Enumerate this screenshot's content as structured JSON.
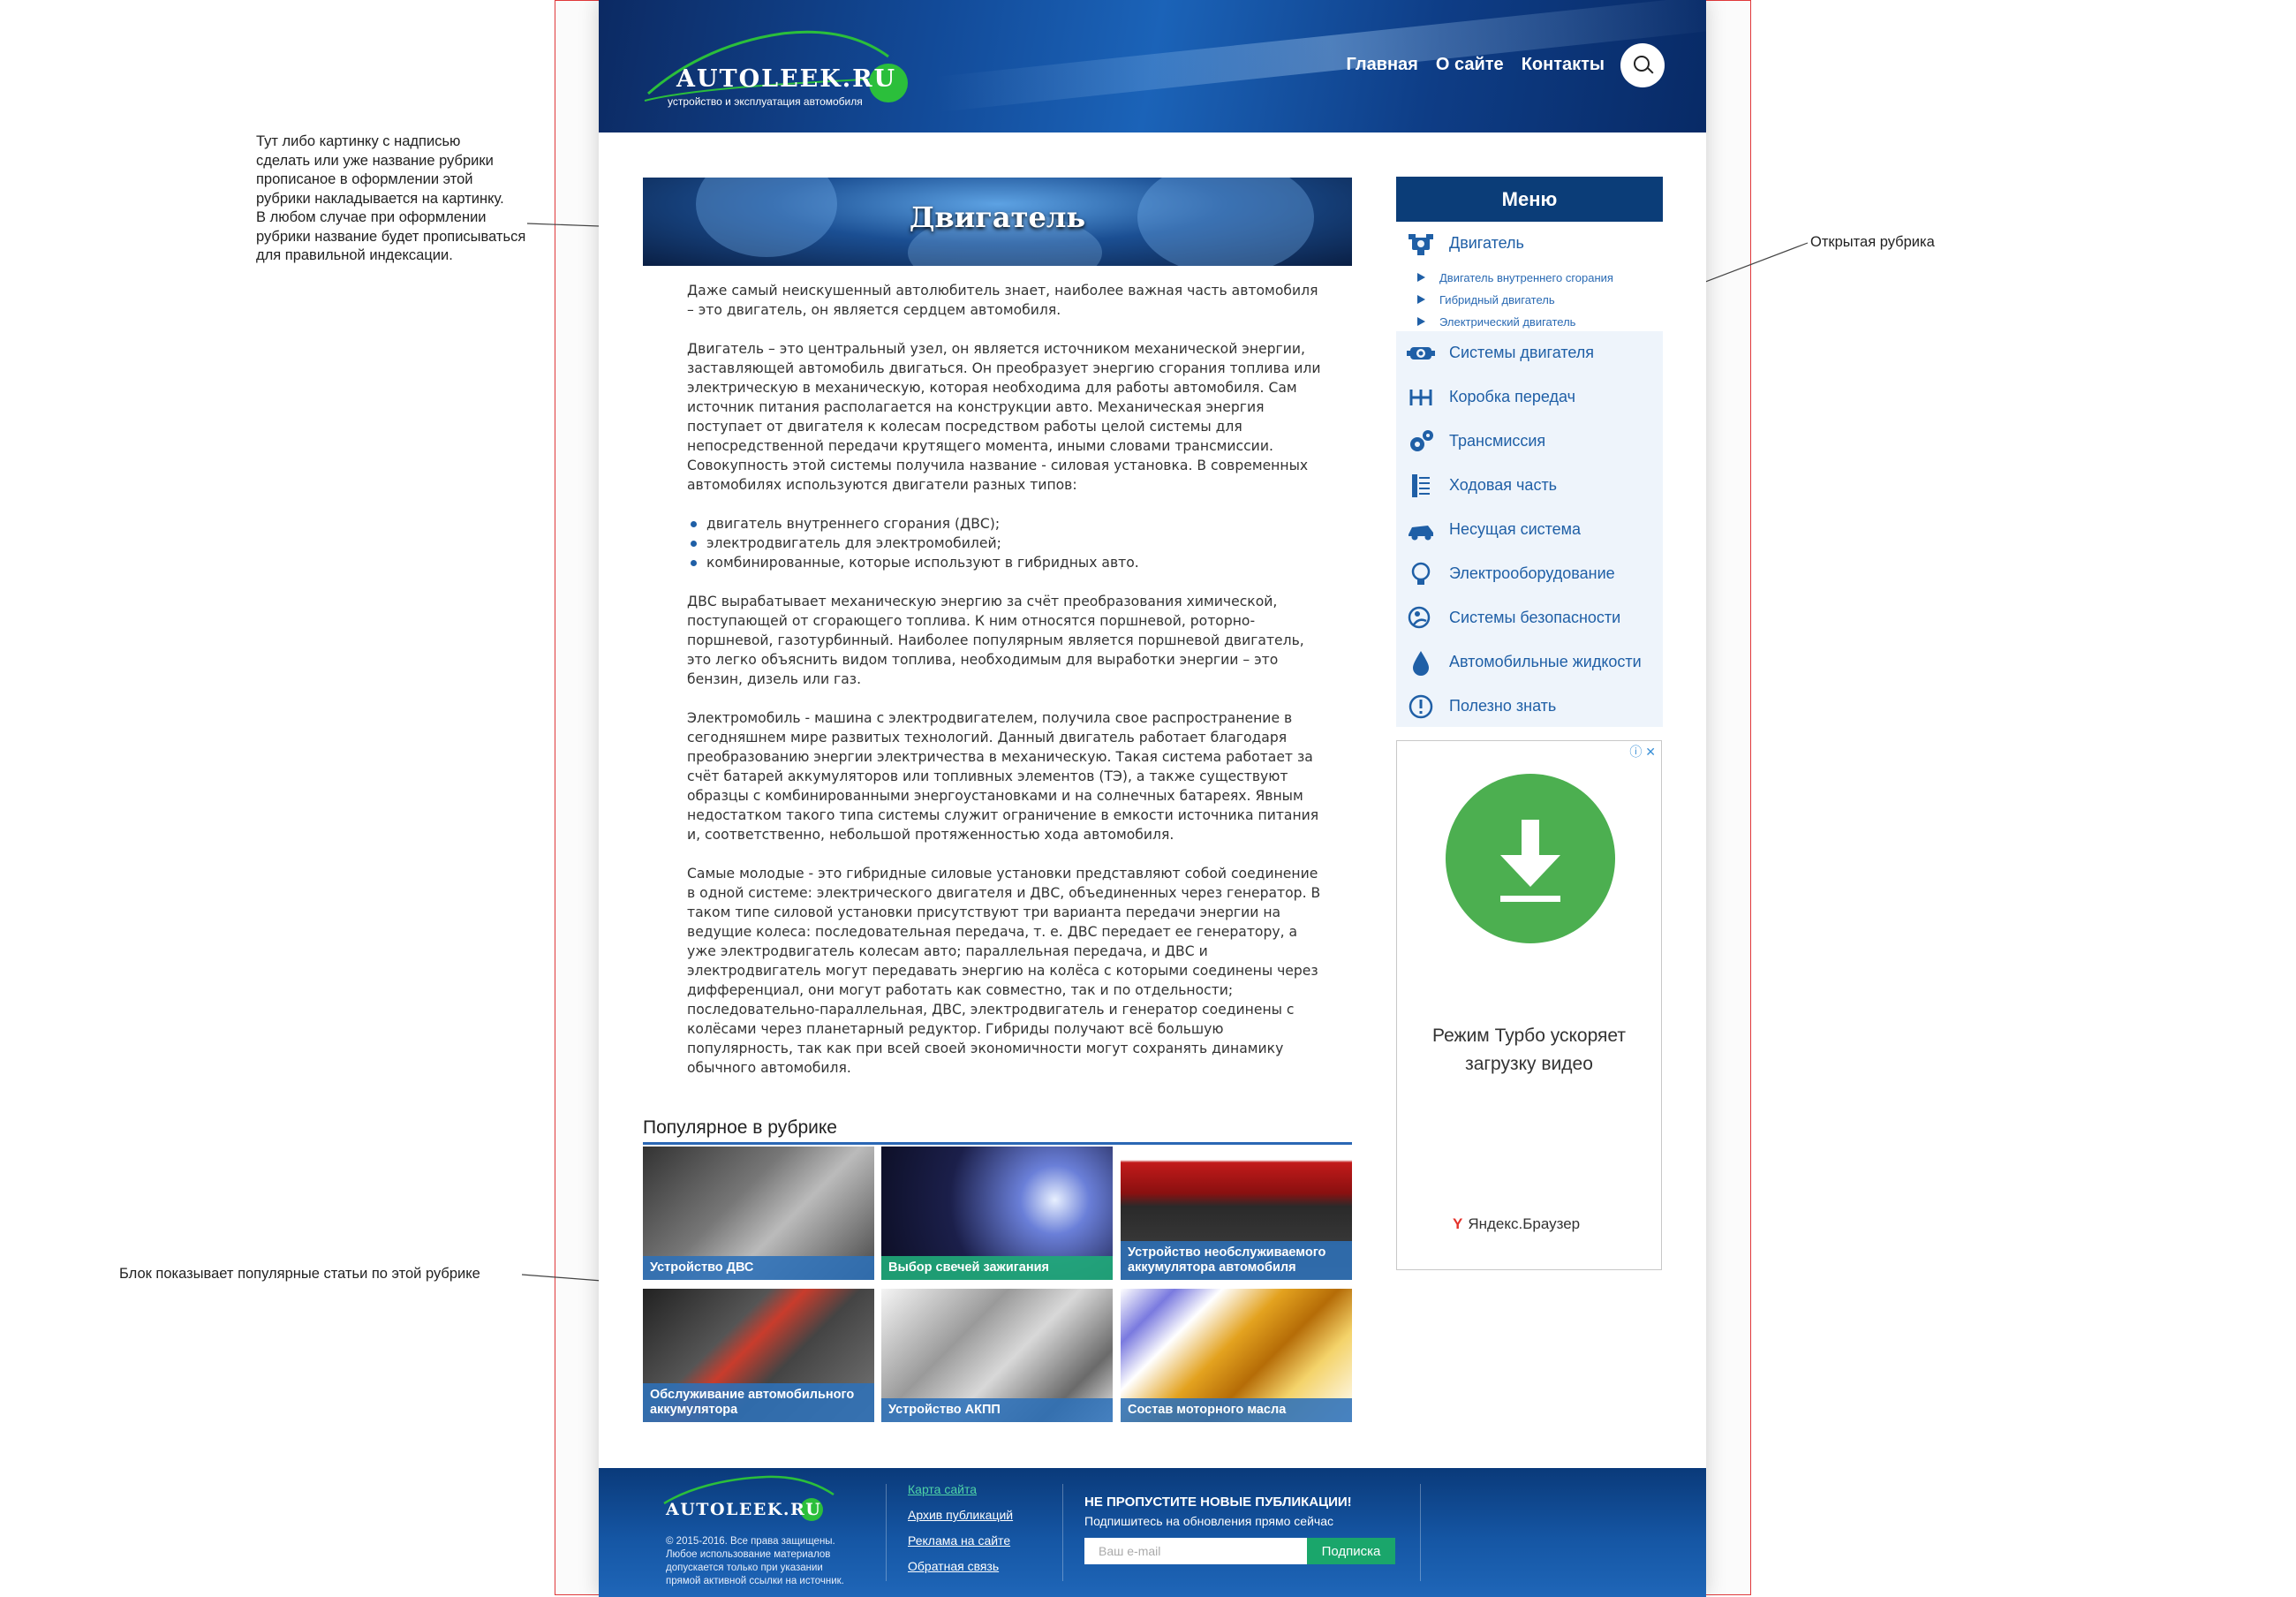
{
  "header": {
    "logo_text": "AUTOLEEK.RU",
    "logo_sub": "устройство и эксплуатация автомобиля",
    "nav": [
      "Главная",
      "О сайте",
      "Контакты"
    ]
  },
  "banner": {
    "title": "Двигатель"
  },
  "article": {
    "p1": "Даже самый неискушенный автолюбитель знает, наиболее важная часть автомобиля – это двигатель, он является сердцем автомобиля.",
    "p2": "Двигатель – это центральный узел, он является источником механической энергии, заставляющей автомобиль двигаться. Он преобразует энергию сгорания топлива или электрическую в механическую, которая необходима для работы автомобиля. Сам источник питания располагается на конструкции авто. Механическая энергия поступает от двигателя к колесам посредством работы целой системы для непосредственной передачи крутящего момента, иными словами трансмиссии. Совокупность этой системы получила название - силовая установка. В современных автомобилях используются двигатели разных типов:",
    "list": [
      "двигатель внутреннего сгорания (ДВС);",
      "электродвигатель для электромобилей;",
      "комбинированные, которые используют в гибридных авто."
    ],
    "p3": "ДВС вырабатывает механическую энергию за счёт преобразования химической, поступающей от сгорающего топлива. К ним относятся поршневой, роторно-поршневой, газотурбинный. Наиболее популярным является поршневой двигатель, это легко объяснить видом топлива, необходимым для выработки энергии – это бензин, дизель или газ.",
    "p4": "Электромобиль - машина с электродвигателем, получила свое распространение в сегодняшнем мире развитых технологий. Данный двигатель работает благодаря преобразованию энергии электричества в механическую. Такая система работает за счёт батарей аккумуляторов или топливных элементов (ТЭ), а также существуют образцы с комбинированными энергоустановками и на солнечных батареях. Явным недостатком такого типа системы служит ограничение в емкости источника питания и, соответственно, небольшой протяженностью хода автомобиля.",
    "p5": "Самые молодые - это гибридные силовые установки представляют собой соединение в одной системе: электрического двигателя и ДВС, объединенных через генератор. В таком типе силовой установки присутствуют три варианта передачи энергии на ведущие колеса: последовательная передача, т. е. ДВС передает ее генератору, а уже электродвигатель колесам авто; параллельная передача, и ДВС и электродвигатель могут передавать энергию на колёса с которыми соединены через дифференциал, они могут работать как совместно, так и по отдельности; последовательно-параллельная, ДВС, электродвигатель и генератор соединены с колёсами через планетарный редуктор. Гибриды получают всё большую популярность, так как при всей своей экономичности могут сохранять динамику обычного автомобиля."
  },
  "popular": {
    "title": "Популярное в рубрике",
    "tiles": [
      "Устройство ДВС",
      "Выбор свечей зажигания",
      "Устройство необслуживаемого аккумулятора автомобиля",
      "Обслуживание автомобильного аккумулятора",
      "Устройство АКПП",
      "Состав моторного масла"
    ]
  },
  "menu": {
    "title": "Меню",
    "items": [
      "Двигатель",
      "Системы двигателя",
      "Коробка передач",
      "Трансмиссия",
      "Ходовая часть",
      "Несущая система",
      "Электрооборудование",
      "Системы безопасности",
      "Автомобильные жидкости",
      "Полезно знать"
    ],
    "sub": [
      "Двигатель внутреннего сгорания",
      "Гибридный двигатель",
      "Электрический двигатель"
    ]
  },
  "ad": {
    "text_line1": "Режим Турбо ускоряет",
    "text_line2": "загрузку видео",
    "brand": "Яндекс.Браузер"
  },
  "footer": {
    "logo_text": "AUTOLEEK.RU",
    "copyright": "© 2015-2016. Все права защищены. Любое использование материалов допускается только при указании прямой активной ссылки на источник.",
    "links": [
      "Карта сайта",
      "Архив публикаций",
      "Реклама на сайте",
      "Обратная связь"
    ],
    "subscribe_title": "НЕ ПРОПУСТИТЕ НОВЫЕ ПУБЛИКАЦИИ!",
    "subscribe_text": "Подпишитесь на обновления прямо сейчас",
    "email_placeholder": "Ваш e-mail",
    "subscribe_button": "Подписка"
  },
  "annotations": {
    "left_top": [
      "Тут либо картинку с надписью",
      "сделать или уже название рубрики",
      "прописаное в оформлении этой",
      "рубрики накладывается на картинку.",
      "В любом случае при оформлении",
      "рубрики название будет прописываться",
      "для правильной индексации."
    ],
    "left_bottom": "Блок показывает популярные статьи по этой рубрике",
    "right": "Открытая рубрика"
  },
  "colors": {
    "header_blue": "#124a98",
    "menu_head": "#0b3d78",
    "link_blue": "#1f5fa6",
    "accent_green": "#1aa66b",
    "frame_red": "#e0383a"
  }
}
